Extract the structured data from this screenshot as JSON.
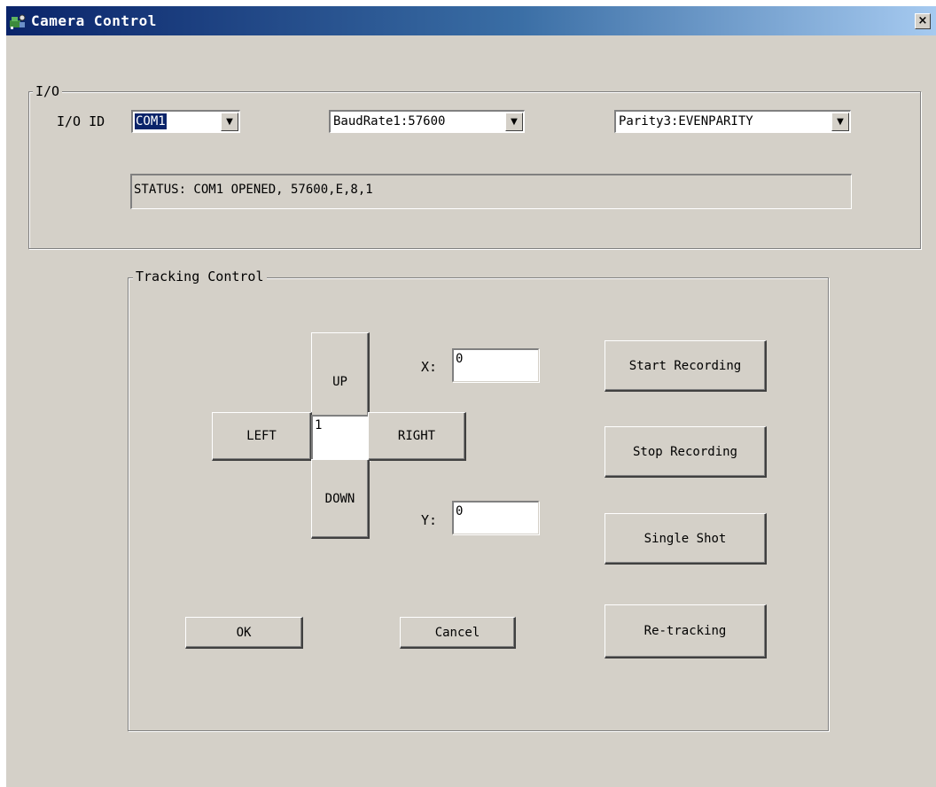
{
  "window": {
    "title": "Camera Control",
    "close_glyph": "×",
    "icon": "camera-control-app-icon"
  },
  "io_group": {
    "label": "I/O",
    "io_id_label": "I/O ID",
    "port": {
      "selected": "COM1"
    },
    "baud": {
      "selected": "BaudRate1:57600"
    },
    "parity": {
      "selected": "Parity3:EVENPARITY"
    },
    "status": "STATUS: COM1 OPENED, 57600,E,8,1",
    "dropdown_arrow": "▼"
  },
  "tracking": {
    "label": "Tracking Control",
    "up": "UP",
    "down": "DOWN",
    "left": "LEFT",
    "right": "RIGHT",
    "step": "1",
    "x_label": "X:",
    "x_value": "0",
    "y_label": "Y:",
    "y_value": "0",
    "start_recording": "Start Recording",
    "stop_recording": "Stop Recording",
    "single_shot": "Single Shot",
    "retracking": "Re-tracking",
    "ok": "OK",
    "cancel": "Cancel"
  },
  "colors": {
    "title_active": "#0a246a",
    "title_gradient_end": "#a6caf0",
    "face": "#d4d0c8",
    "selection": "#0a246a"
  }
}
